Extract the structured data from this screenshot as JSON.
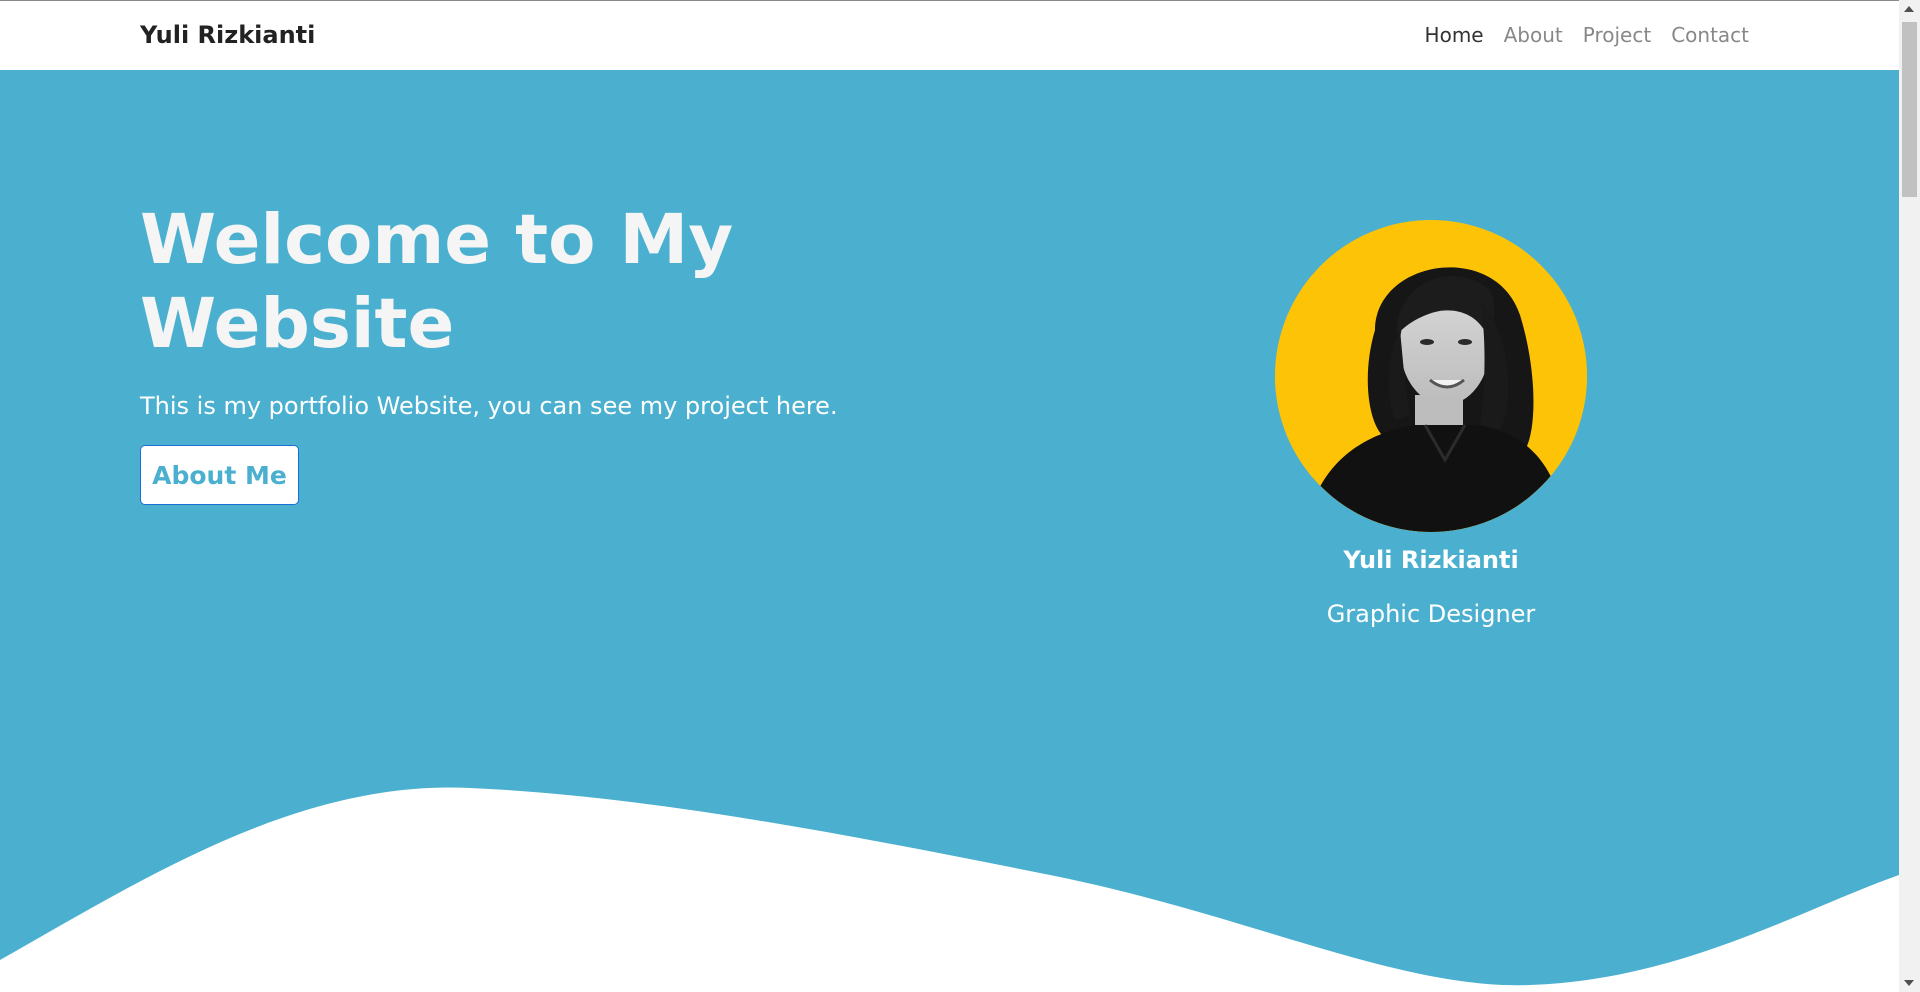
{
  "navbar": {
    "brand": "Yuli Rizkianti",
    "links": [
      {
        "label": "Home",
        "active": true
      },
      {
        "label": "About",
        "active": false
      },
      {
        "label": "Project",
        "active": false
      },
      {
        "label": "Contact",
        "active": false
      }
    ]
  },
  "hero": {
    "title": "Welcome to My Website",
    "subtitle": "This is my portfolio Website, you can see my project here.",
    "button_label": "About Me"
  },
  "profile": {
    "name": "Yuli Rizkianti",
    "role": "Graphic Designer"
  },
  "colors": {
    "hero_bg": "#4bb0cf",
    "avatar_bg": "#fdc307",
    "button_border": "#1d6fd6"
  }
}
